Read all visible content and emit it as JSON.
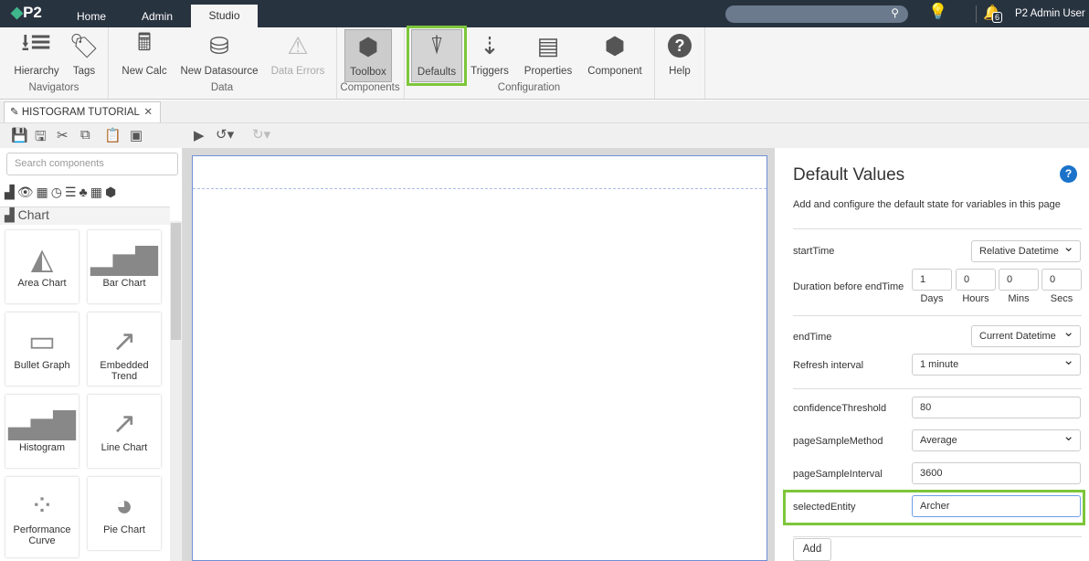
{
  "topbar": {
    "logo": "P2",
    "tabs": [
      "Home",
      "Admin",
      "Studio"
    ],
    "notifications": "6",
    "user": "P2 Admin User"
  },
  "ribbon": {
    "buttons": [
      "Hierarchy",
      "Tags",
      "New Calc",
      "New Datasource",
      "Data Errors",
      "Toolbox",
      "Defaults",
      "Triggers",
      "Properties",
      "Component",
      "Help"
    ],
    "groups": [
      "Navigators",
      "Data",
      "Components",
      "Configuration"
    ]
  },
  "document_tab": "HISTOGRAM TUTORIAL",
  "left": {
    "search_placeholder": "Search components",
    "category": "Chart",
    "components": [
      "Area Chart",
      "Bar Chart",
      "Bullet Graph",
      "Embedded Trend",
      "Histogram",
      "Line Chart",
      "Performance Curve",
      "Pie Chart"
    ]
  },
  "defaults": {
    "title": "Default Values",
    "description": "Add and configure the default state for variables in this page",
    "startTime": {
      "label": "startTime",
      "value": "Relative Datetime"
    },
    "duration": {
      "label": "Duration before endTime",
      "values": [
        "1",
        "0",
        "0",
        "0"
      ],
      "units": [
        "Days",
        "Hours",
        "Mins",
        "Secs"
      ]
    },
    "endTime": {
      "label": "endTime",
      "value": "Current Datetime"
    },
    "refresh": {
      "label": "Refresh interval",
      "value": "1 minute"
    },
    "confidence": {
      "label": "confidenceThreshold",
      "value": "80"
    },
    "method": {
      "label": "pageSampleMethod",
      "value": "Average"
    },
    "interval": {
      "label": "pageSampleInterval",
      "value": "3600"
    },
    "entity": {
      "label": "selectedEntity",
      "value": "Archer"
    },
    "add": "Add"
  },
  "colors": {
    "highlight": "#7dc63a",
    "topbar": "#283340",
    "help": "#1a73c9"
  }
}
